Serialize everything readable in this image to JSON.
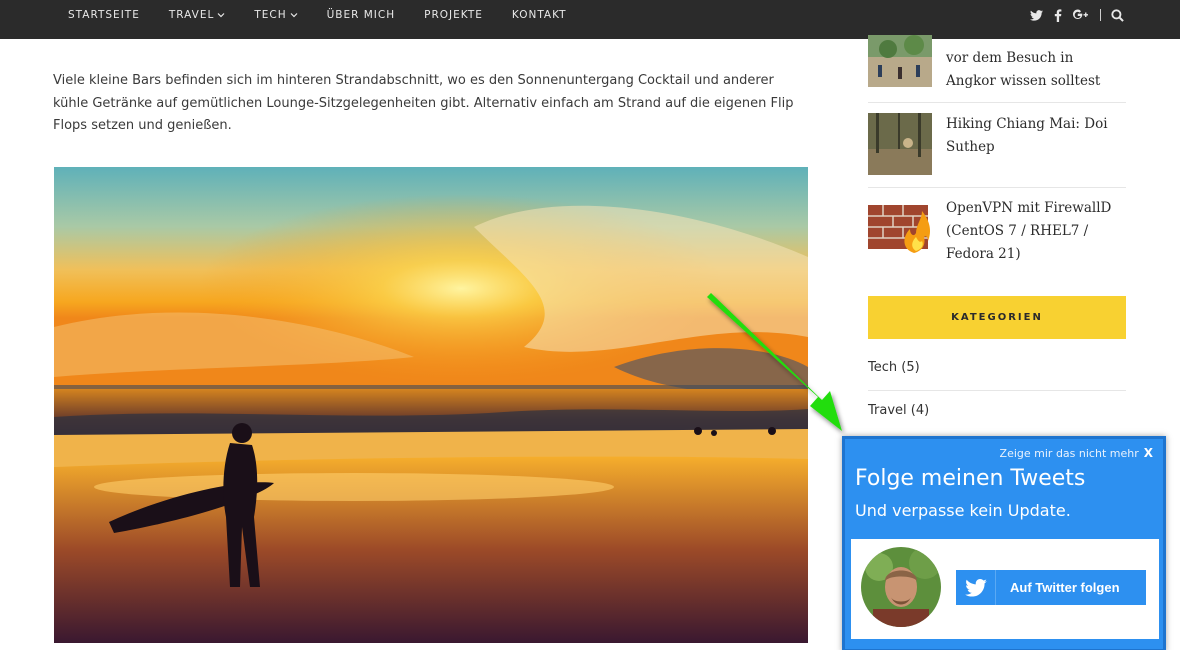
{
  "nav": {
    "items": [
      {
        "label": "STARTSEITE",
        "dropdown": false
      },
      {
        "label": "TRAVEL",
        "dropdown": true
      },
      {
        "label": "TECH",
        "dropdown": true
      },
      {
        "label": "ÜBER MICH",
        "dropdown": false
      },
      {
        "label": "PROJEKTE",
        "dropdown": false
      },
      {
        "label": "KONTAKT",
        "dropdown": false
      }
    ],
    "social_icons": [
      "twitter-icon",
      "facebook-icon",
      "google-plus-icon",
      "search-icon"
    ]
  },
  "article": {
    "paragraph": "Viele kleine Bars befinden sich im hinteren Strandabschnitt, wo es den Sonnenuntergang Cocktail und anderer kühle Getränke auf gemütlichen Lounge-Sitzgelegenheiten gibt. Alternativ einfach am Strand auf die eigenen Flip Flops setzen und genießen."
  },
  "sidebar": {
    "recent_posts": [
      {
        "title_line_partial": "vor dem Besuch in Angkor wissen solltest"
      },
      {
        "title": "Hiking Chiang Mai: Doi Suthep"
      },
      {
        "title": "OpenVPN mit FirewallD (CentOS 7 / RHEL7 / Fedora 21)"
      }
    ],
    "categories_heading": "KATEGORIEN",
    "categories": [
      {
        "label": "Tech (5)"
      },
      {
        "label": "Travel (4)"
      }
    ]
  },
  "popup": {
    "dismiss_label": "Zeige mir das nicht mehr",
    "close_label": "X",
    "title": "Folge meinen Tweets",
    "subtitle": "Und verpasse kein Update.",
    "follow_button_label": "Auf Twitter folgen"
  },
  "colors": {
    "topbar": "#2b2b2b",
    "category_heading": "#f8d131",
    "popup_blue": "#2d90f0",
    "arrow_green": "#22dd11"
  }
}
